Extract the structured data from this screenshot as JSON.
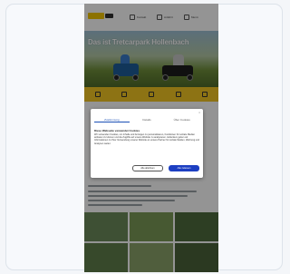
{
  "site": {
    "logo_text": "",
    "nav": [
      {
        "label": "Kontakt",
        "icon": "phone-icon"
      },
      {
        "label": "Anfahrt",
        "icon": "map-pin-icon"
      },
      {
        "label": "Menü",
        "icon": "menu-icon"
      }
    ]
  },
  "hero": {
    "title": "Das ist Tretcarpark Hollenbach"
  },
  "feature_strip": {
    "icons": [
      "kart-icon",
      "calendar-icon",
      "ticket-icon",
      "group-icon",
      "info-icon"
    ]
  },
  "consent_dialog": {
    "close_label": "×",
    "tabs": [
      {
        "label": "Zustimmung",
        "active": true
      },
      {
        "label": "Details",
        "active": false
      },
      {
        "label": "Über Cookies",
        "active": false
      }
    ],
    "title": "Diese Webseite verwendet Cookies",
    "body": "Wir verwenden Cookies, um Inhalte und Anzeigen zu personalisieren, Funktionen für soziale Medien anbieten zu können und die Zugriffe auf unsere Website zu analysieren. Außerdem geben wir Informationen zu Ihrer Verwendung unserer Website an unsere Partner für soziale Medien, Werbung und Analysen weiter.",
    "deny_label": "Alle ablehnen",
    "accept_label": "Alle zulassen",
    "accent_color": "#1d3fc2"
  },
  "colors": {
    "brand_yellow": "#f3c623",
    "overlay": "rgba(0,0,0,0.42)"
  }
}
